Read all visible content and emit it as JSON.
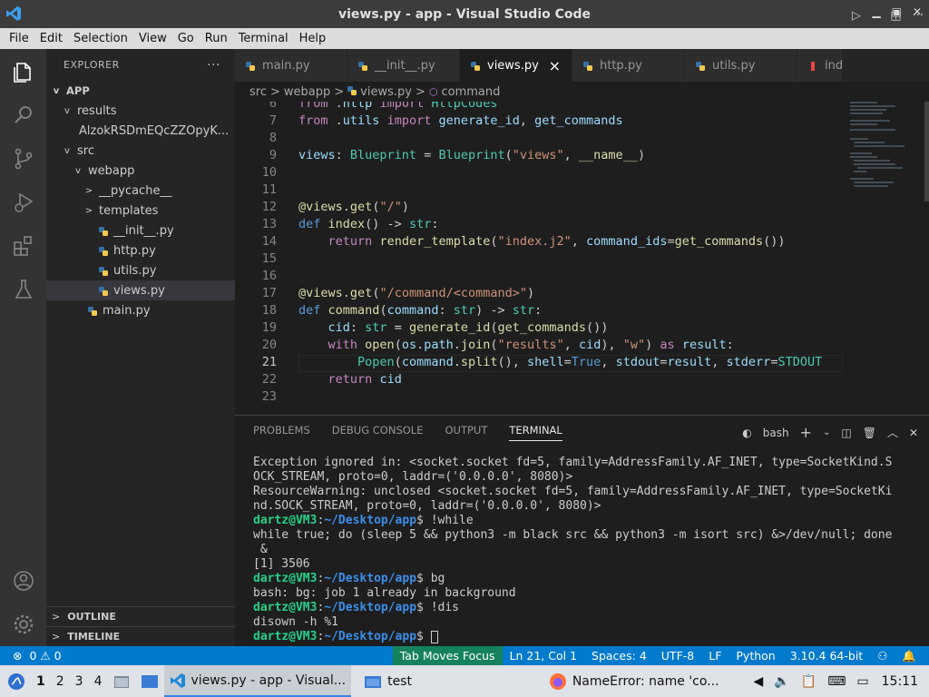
{
  "window": {
    "title": "views.py - app - Visual Studio Code"
  },
  "menu": [
    "File",
    "Edit",
    "Selection",
    "View",
    "Go",
    "Run",
    "Terminal",
    "Help"
  ],
  "explorer": {
    "header": "EXPLORER",
    "more": "···",
    "root": "APP",
    "tree": [
      {
        "label": "results",
        "depth": 1,
        "chevron": "v",
        "py": false
      },
      {
        "label": "AlzokRSDmEQcZZOpyK...",
        "depth": 2,
        "chevron": "",
        "py": false
      },
      {
        "label": "src",
        "depth": 1,
        "chevron": "v",
        "py": false
      },
      {
        "label": "webapp",
        "depth": 2,
        "chevron": "v",
        "py": false
      },
      {
        "label": "__pycache__",
        "depth": 3,
        "chevron": ">",
        "py": false
      },
      {
        "label": "templates",
        "depth": 3,
        "chevron": ">",
        "py": false
      },
      {
        "label": "__init__.py",
        "depth": 3,
        "chevron": "",
        "py": true
      },
      {
        "label": "http.py",
        "depth": 3,
        "chevron": "",
        "py": true
      },
      {
        "label": "utils.py",
        "depth": 3,
        "chevron": "",
        "py": true
      },
      {
        "label": "views.py",
        "depth": 3,
        "chevron": "",
        "py": true,
        "selected": true
      },
      {
        "label": "main.py",
        "depth": 2,
        "chevron": "",
        "py": true
      }
    ],
    "outline": "OUTLINE",
    "timeline": "TIMELINE"
  },
  "tabs": [
    {
      "label": "main.py"
    },
    {
      "label": "__init__.py"
    },
    {
      "label": "views.py",
      "active": true,
      "close": "×"
    },
    {
      "label": "http.py"
    },
    {
      "label": "utils.py"
    },
    {
      "label": "ind"
    }
  ],
  "breadcrumb": [
    "src",
    ">",
    "webapp",
    ">",
    "views.py",
    ">",
    "command"
  ],
  "editor": {
    "lines": [
      {
        "n": "6",
        "code": "from .http import HttpCodes"
      },
      {
        "n": "7",
        "code": "from .utils import generate_id, get_commands"
      },
      {
        "n": "8",
        "code": ""
      },
      {
        "n": "9",
        "code": "views: Blueprint = Blueprint(\"views\", __name__)"
      },
      {
        "n": "10",
        "code": ""
      },
      {
        "n": "11",
        "code": ""
      },
      {
        "n": "12",
        "code": "@views.get(\"/\")"
      },
      {
        "n": "13",
        "code": "def index() -> str:"
      },
      {
        "n": "14",
        "code": "    return render_template(\"index.j2\", command_ids=get_commands())"
      },
      {
        "n": "15",
        "code": ""
      },
      {
        "n": "16",
        "code": ""
      },
      {
        "n": "17",
        "code": "@views.get(\"/command/<command>\")"
      },
      {
        "n": "18",
        "code": "def command(command: str) -> str:"
      },
      {
        "n": "19",
        "code": "    cid: str = generate_id(get_commands())"
      },
      {
        "n": "20",
        "code": "    with open(os.path.join(\"results\", cid), \"w\") as result:"
      },
      {
        "n": "21",
        "code": "        Popen(command.split(), shell=True, stdout=result, stderr=STDOUT"
      },
      {
        "n": "22",
        "code": "    return cid"
      },
      {
        "n": "23",
        "code": ""
      }
    ]
  },
  "panel": {
    "tabs": [
      "PROBLEMS",
      "DEBUG CONSOLE",
      "OUTPUT",
      "TERMINAL"
    ],
    "shell": "bash",
    "terminal": [
      {
        "t": "Exception ignored in: <socket.socket fd=5, family=AddressFamily.AF_INET, type=SocketKind.S"
      },
      {
        "t": "OCK_STREAM, proto=0, laddr=('0.0.0.0', 8080)>"
      },
      {
        "t": "ResourceWarning: unclosed <socket.socket fd=5, family=AddressFamily.AF_INET, type=SocketKi"
      },
      {
        "t": "nd.SOCK_STREAM, proto=0, laddr=('0.0.0.0', 8080)>"
      },
      {
        "prompt": true,
        "user": "dartz@VM3",
        "path": "~/Desktop/app",
        "cmd": "!while"
      },
      {
        "t": "while true; do (sleep 5 && python3 -m black src && python3 -m isort src) &>/dev/null; done"
      },
      {
        "t": " &"
      },
      {
        "t": "[1] 3506"
      },
      {
        "prompt": true,
        "user": "dartz@VM3",
        "path": "~/Desktop/app",
        "cmd": "bg"
      },
      {
        "t": "bash: bg: job 1 already in background"
      },
      {
        "prompt": true,
        "user": "dartz@VM3",
        "path": "~/Desktop/app",
        "cmd": "!dis"
      },
      {
        "t": "disown -h %1"
      },
      {
        "prompt": true,
        "user": "dartz@VM3",
        "path": "~/Desktop/app",
        "cmd": "",
        "cursor": true
      }
    ]
  },
  "status": {
    "errors": "0",
    "warnings": "0",
    "focus": "Tab Moves Focus",
    "position": "Ln 21, Col 1",
    "spaces": "Spaces: 4",
    "encoding": "UTF-8",
    "eol": "LF",
    "language": "Python",
    "interpreter": "3.10.4 64-bit"
  },
  "taskbar": {
    "workspaces": [
      "1",
      "2",
      "3",
      "4"
    ],
    "vscode": "views.py - app - Visual...",
    "folder": "test",
    "firefox": "NameError: name 'co...",
    "clock": "15:11"
  }
}
